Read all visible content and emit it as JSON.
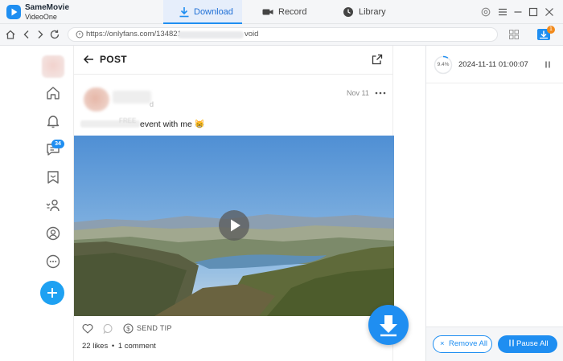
{
  "app": {
    "name": "SameMovie",
    "subtitle": "VideoOne"
  },
  "tabs": [
    {
      "label": "Download",
      "active": true
    },
    {
      "label": "Record",
      "active": false
    },
    {
      "label": "Library",
      "active": false
    }
  ],
  "address": {
    "url_prefix": "https://onlyfans.com/134821",
    "url_suffix": "void",
    "queue_badge": "1"
  },
  "left_nav": {
    "messages_badge": "34",
    "icons": [
      "home-icon",
      "bell-icon",
      "chat-icon",
      "bookmark-icon",
      "user-list-icon",
      "profile-icon",
      "more-circle-icon",
      "plus-icon"
    ]
  },
  "post": {
    "header_title": "POST",
    "author_suffix": "d",
    "date": "Nov 11",
    "caption_hidden": "FREE",
    "caption": "event with me 😸",
    "send_tip": "SEND TIP",
    "likes": "22 likes",
    "separator": "•",
    "comments": "1 comment"
  },
  "tasks": [
    {
      "progress": "9.4%",
      "progress_value": 0.094,
      "time": "2024-11-11 01:00:07"
    }
  ],
  "footer": {
    "remove_all": "Remove All",
    "pause_all": "Pause All"
  },
  "colors": {
    "accent": "#1f8ef1",
    "badge_orange": "#f28a1b"
  }
}
